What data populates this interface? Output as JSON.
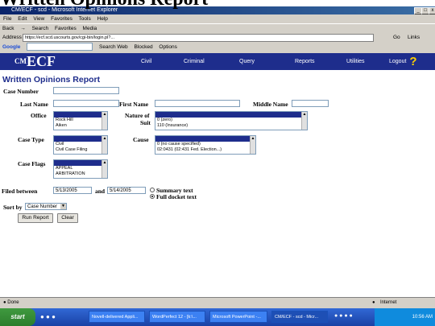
{
  "page_title": "Written Opinions Report",
  "window": {
    "title": "CM/ECF - scd - Microsoft Internet Explorer",
    "min": "_",
    "max": "□",
    "close": "x"
  },
  "menubar": [
    "File",
    "Edit",
    "View",
    "Favorites",
    "Tools",
    "Help"
  ],
  "toolbar": [
    "Back",
    "→",
    "Search",
    "Favorites",
    "Media"
  ],
  "address": {
    "label": "Address",
    "url": "https://ecf.scd.uscourts.gov/cgi-bin/login.pl?...",
    "go": "Go",
    "links": "Links"
  },
  "googlebar": {
    "logo": "Google",
    "search_web": "Search Web",
    "blocked": "Blocked",
    "options": "Options"
  },
  "ecf": {
    "logo": "ECF",
    "nav": [
      "Civil",
      "Criminal",
      "Query",
      "Reports",
      "Utilities",
      "Logout"
    ],
    "help_icon": "?"
  },
  "form": {
    "heading": "Written Opinions Report",
    "case_number_label": "Case Number",
    "last_name_label": "Last Name",
    "first_name_label": "First Name",
    "middle_name_label": "Middle Name",
    "office_label": "Office",
    "office_options": [
      "Rock Hill",
      "Aiken"
    ],
    "nature_of_suit_label": "Nature of",
    "nature_of_suit_label2": "Suit",
    "nature_options": [
      "0 (zero)",
      "110 (Insurance)"
    ],
    "case_type_label": "Case Type",
    "case_type_options": [
      "Civil",
      "Civil Case Filing"
    ],
    "cause_label": "Cause",
    "cause_options": [
      "0 (no cause specified)",
      "02:0431 (02:431 Fed. Election...)"
    ],
    "case_flags_label": "Case Flags",
    "case_flags_options": [
      "APPEAL",
      "ARBITRATION"
    ],
    "filed_between_label": "Filed between",
    "date_from": "5/13/2005",
    "and_label": "and",
    "date_to": "5/14/2005",
    "summary_text_label": "Summary text",
    "full_docket_label": "Full docket text",
    "sort_by_label": "Sort by",
    "sort_by_value": "Case Number",
    "run_report": "Run Report",
    "clear": "Clear"
  },
  "status": {
    "done": "Done",
    "zone": "Internet"
  },
  "taskbar": {
    "start": "start",
    "tasks": [
      "Novell-delivered Appli...",
      "WordPerfect 12 - [k:\\...",
      "Microsoft PowerPoint -...",
      "CM/ECF - scd - Micr..."
    ],
    "clock": "10:56 AM"
  }
}
